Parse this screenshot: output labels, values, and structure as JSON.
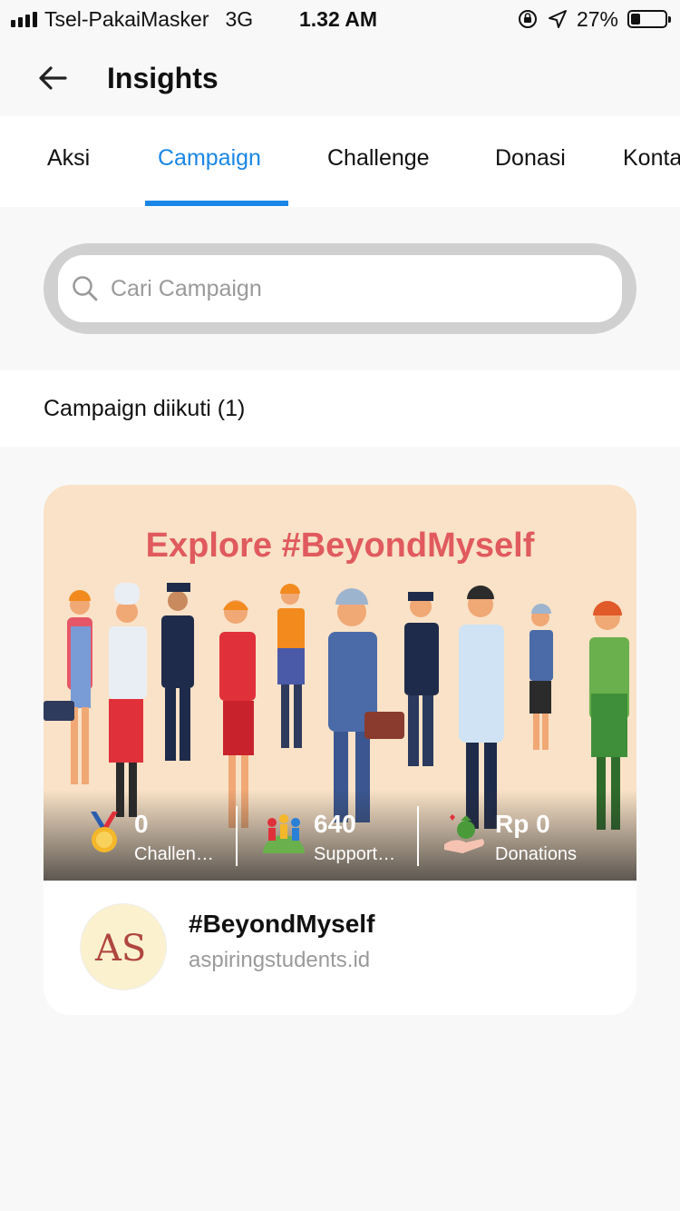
{
  "status_bar": {
    "carrier": "Tsel-PakaiMasker",
    "network": "3G",
    "time": "1.32 AM",
    "battery": "27%",
    "battery_level": 0.27
  },
  "header": {
    "title": "Insights",
    "back_icon": "arrow-left-icon"
  },
  "tabs": {
    "items": [
      {
        "label": "Aksi",
        "active": false
      },
      {
        "label": "Campaign",
        "active": true
      },
      {
        "label": "Challenge",
        "active": false
      },
      {
        "label": "Donasi",
        "active": false
      },
      {
        "label": "Kontak",
        "active": false
      }
    ],
    "accent_color": "#1a86e6"
  },
  "search": {
    "placeholder": "Cari Campaign",
    "icon": "search-icon"
  },
  "followed": {
    "label": "Campaign diikuti (1)"
  },
  "campaign_card": {
    "banner_title": "Explore #BeyondMyself",
    "stats": [
      {
        "value": "0",
        "label": "Challenges",
        "icon": "medal-icon"
      },
      {
        "value": "640",
        "label": "Supporters",
        "icon": "supporters-icon"
      },
      {
        "value": "Rp 0",
        "label": "Donations",
        "icon": "donation-icon"
      }
    ],
    "name": "#BeyondMyself",
    "username": "aspiringstudents.id",
    "avatar_logo": "AS"
  }
}
